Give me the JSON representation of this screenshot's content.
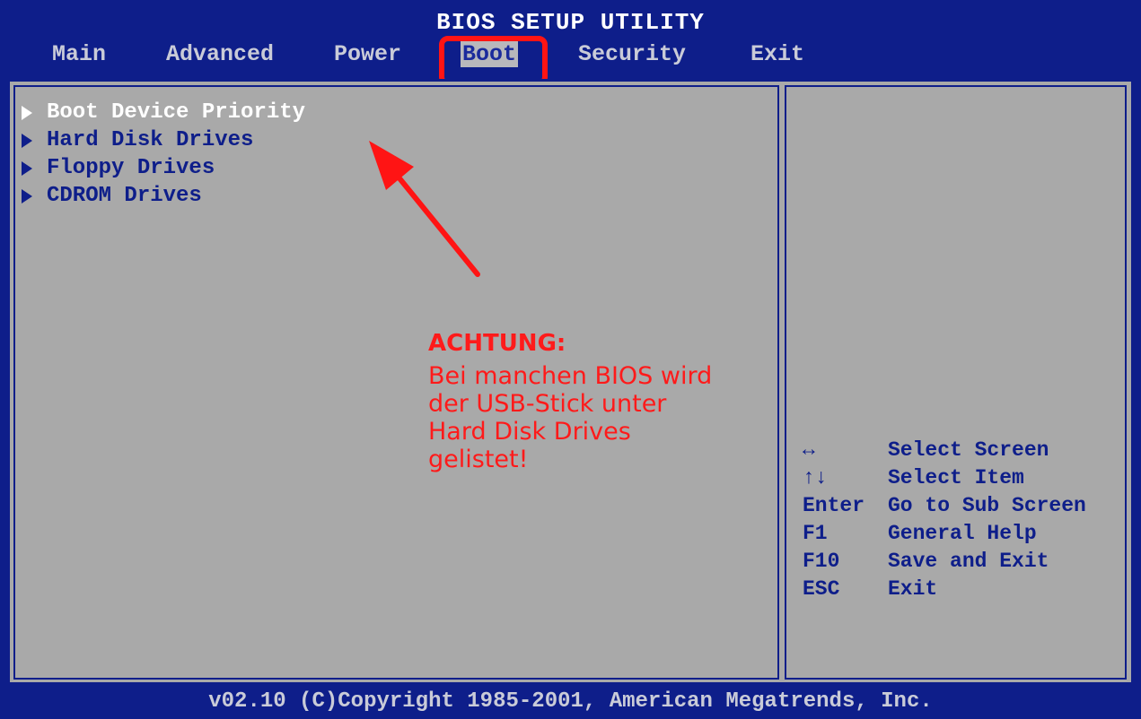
{
  "title": "BIOS SETUP UTILITY",
  "menu": {
    "items": [
      {
        "label": "Main"
      },
      {
        "label": "Advanced"
      },
      {
        "label": "Power"
      },
      {
        "label": "Boot"
      },
      {
        "label": "Security"
      },
      {
        "label": "Exit"
      }
    ],
    "active": "Boot"
  },
  "boot_options": [
    {
      "label": "Boot Device Priority"
    },
    {
      "label": "Hard Disk Drives"
    },
    {
      "label": "Floppy Drives"
    },
    {
      "label": "CDROM Drives"
    }
  ],
  "annotation": {
    "heading": "ACHTUNG:",
    "text": "Bei manchen BIOS wird der USB-Stick unter Hard Disk Drives gelistet!",
    "color": "#ff1a1a"
  },
  "help": [
    {
      "key": "↔",
      "action": "Select Screen"
    },
    {
      "key": "↑↓",
      "action": "Select Item"
    },
    {
      "key": "Enter",
      "action": "Go to Sub Screen"
    },
    {
      "key": "F1",
      "action": "General Help"
    },
    {
      "key": "F10",
      "action": "Save and Exit"
    },
    {
      "key": "ESC",
      "action": "Exit"
    }
  ],
  "footer": "v02.10 (C)Copyright 1985-2001, American Megatrends, Inc.",
  "colors": {
    "background": "#0e1e8a",
    "panel": "#a9a9a9",
    "highlight_box": "#ff1414"
  }
}
